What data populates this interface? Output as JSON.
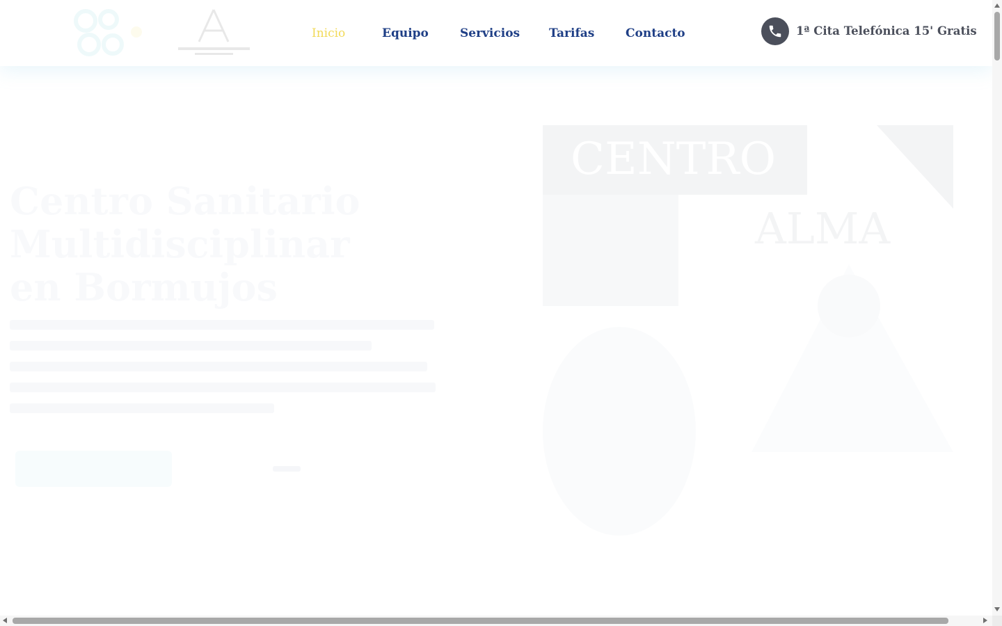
{
  "header": {
    "nav": [
      {
        "label": "Inicio",
        "active": true
      },
      {
        "label": "Equipo",
        "active": false
      },
      {
        "label": "Servicios",
        "active": false
      },
      {
        "label": "Tarifas",
        "active": false
      },
      {
        "label": "Contacto",
        "active": false
      }
    ],
    "cta_label": "1ª Cita Telefónica 15' Gratis",
    "cta_icon": "phone-icon"
  },
  "hero": {
    "title": "Centro Sanitario Multidisciplinar en Bormujos",
    "image_text": {
      "top": "CENTRO",
      "middle": "ALMA"
    }
  },
  "colors": {
    "nav_text": "#1f3f86",
    "nav_active": "#f2da58",
    "cta": "#4b4f5b",
    "accent": "#5ecbd7"
  }
}
